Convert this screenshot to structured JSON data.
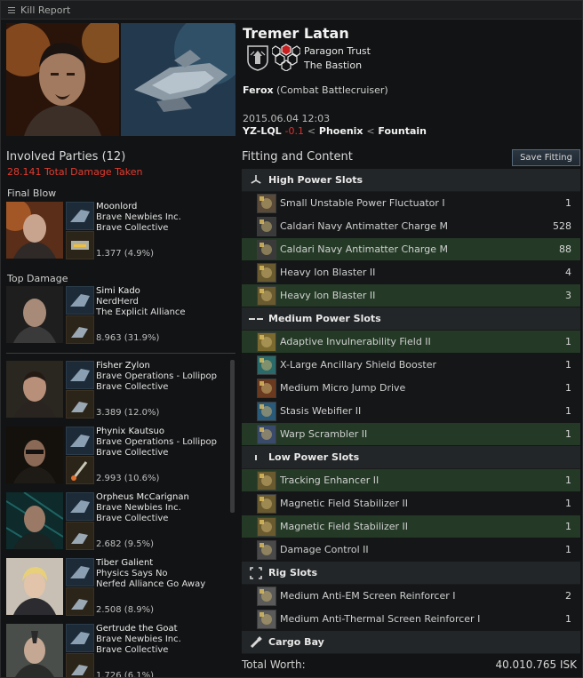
{
  "window": {
    "title": "Kill Report"
  },
  "victim": {
    "name": "Tremer Latan",
    "corp": "Paragon Trust",
    "alliance": "The Bastion",
    "ship_name": "Ferox",
    "ship_class": "(Combat Battlecruiser)",
    "datetime": "2015.06.04 12:03",
    "system": "YZ-LQL",
    "security": "-0.1",
    "separator": "<",
    "constellation": "Phoenix",
    "region": "Fountain"
  },
  "involved": {
    "header": "Involved Parties (12)",
    "damage_total": "28.141 Total Damage Taken",
    "final_blow_label": "Final Blow",
    "top_damage_label": "Top Damage",
    "final_blow": {
      "pilot": "Moonlord",
      "corp": "Brave Newbies Inc.",
      "alliance": "Brave Collective",
      "damage": "1.377 (4.9%)"
    },
    "top_damage": {
      "pilot": "Simi Kado",
      "corp": "NerdHerd",
      "alliance": "The Explicit Alliance",
      "damage": "8.963 (31.9%)"
    },
    "others": [
      {
        "pilot": "Fisher Zylon",
        "corp": "Brave Operations - Lollipop",
        "alliance": "Brave Collective",
        "damage": "3.389 (12.0%)"
      },
      {
        "pilot": "Phynix Kautsuo",
        "corp": "Brave Operations - Lollipop",
        "alliance": "Brave Collective",
        "damage": "2.993 (10.6%)"
      },
      {
        "pilot": "Orpheus McCarignan",
        "corp": "Brave Newbies Inc.",
        "alliance": "Brave Collective",
        "damage": "2.682 (9.5%)"
      },
      {
        "pilot": "Tiber Galient",
        "corp": "Physics Says No",
        "alliance": "Nerfed Alliance Go Away",
        "damage": "2.508 (8.9%)"
      },
      {
        "pilot": "Gertrude the Goat",
        "corp": "Brave Newbies Inc.",
        "alliance": "Brave Collective",
        "damage": "1.726 (6.1%)"
      }
    ]
  },
  "fitting": {
    "header": "Fitting and Content",
    "save_button": "Save Fitting",
    "groups": [
      {
        "label": "High Power Slots",
        "icon": "high-slot-icon",
        "items": [
          {
            "name": "Small Unstable Power Fluctuator I",
            "qty": "1",
            "highlight": false,
            "icon": "power-fluctuator-icon"
          },
          {
            "name": "Caldari Navy Antimatter Charge M",
            "qty": "528",
            "highlight": false,
            "icon": "ammo-icon"
          },
          {
            "name": "Caldari Navy Antimatter Charge M",
            "qty": "88",
            "highlight": true,
            "icon": "ammo-icon"
          },
          {
            "name": "Heavy Ion Blaster II",
            "qty": "4",
            "highlight": false,
            "icon": "blaster-icon"
          },
          {
            "name": "Heavy Ion Blaster II",
            "qty": "3",
            "highlight": true,
            "icon": "blaster-icon"
          }
        ]
      },
      {
        "label": "Medium Power Slots",
        "icon": "mid-slot-icon",
        "items": [
          {
            "name": "Adaptive Invulnerability Field II",
            "qty": "1",
            "highlight": true,
            "icon": "shield-hardener-icon"
          },
          {
            "name": "X-Large Ancillary Shield Booster",
            "qty": "1",
            "highlight": false,
            "icon": "shield-booster-icon"
          },
          {
            "name": "Medium Micro Jump Drive",
            "qty": "1",
            "highlight": false,
            "icon": "jump-drive-icon"
          },
          {
            "name": "Stasis Webifier II",
            "qty": "1",
            "highlight": false,
            "icon": "webifier-icon"
          },
          {
            "name": "Warp Scrambler II",
            "qty": "1",
            "highlight": true,
            "icon": "scrambler-icon"
          }
        ]
      },
      {
        "label": "Low Power Slots",
        "icon": "low-slot-icon",
        "items": [
          {
            "name": "Tracking Enhancer II",
            "qty": "1",
            "highlight": true,
            "icon": "tracking-enhancer-icon"
          },
          {
            "name": "Magnetic Field Stabilizer II",
            "qty": "1",
            "highlight": false,
            "icon": "mag-stab-icon"
          },
          {
            "name": "Magnetic Field Stabilizer II",
            "qty": "1",
            "highlight": true,
            "icon": "mag-stab-icon"
          },
          {
            "name": "Damage Control II",
            "qty": "1",
            "highlight": false,
            "icon": "damage-control-icon"
          }
        ]
      },
      {
        "label": "Rig Slots",
        "icon": "rig-slot-icon",
        "items": [
          {
            "name": "Medium Anti-EM Screen Reinforcer I",
            "qty": "2",
            "highlight": false,
            "icon": "rig-icon"
          },
          {
            "name": "Medium Anti-Thermal Screen Reinforcer I",
            "qty": "1",
            "highlight": false,
            "icon": "rig-icon"
          }
        ]
      },
      {
        "label": "Cargo Bay",
        "icon": "cargo-icon",
        "items": []
      }
    ],
    "total_label": "Total Worth:",
    "total_value": "40.010.765 ISK"
  },
  "colors": {
    "highlight_row": "#243a26",
    "security_negative": "#e03030",
    "damage_total": "#e33b2f"
  }
}
